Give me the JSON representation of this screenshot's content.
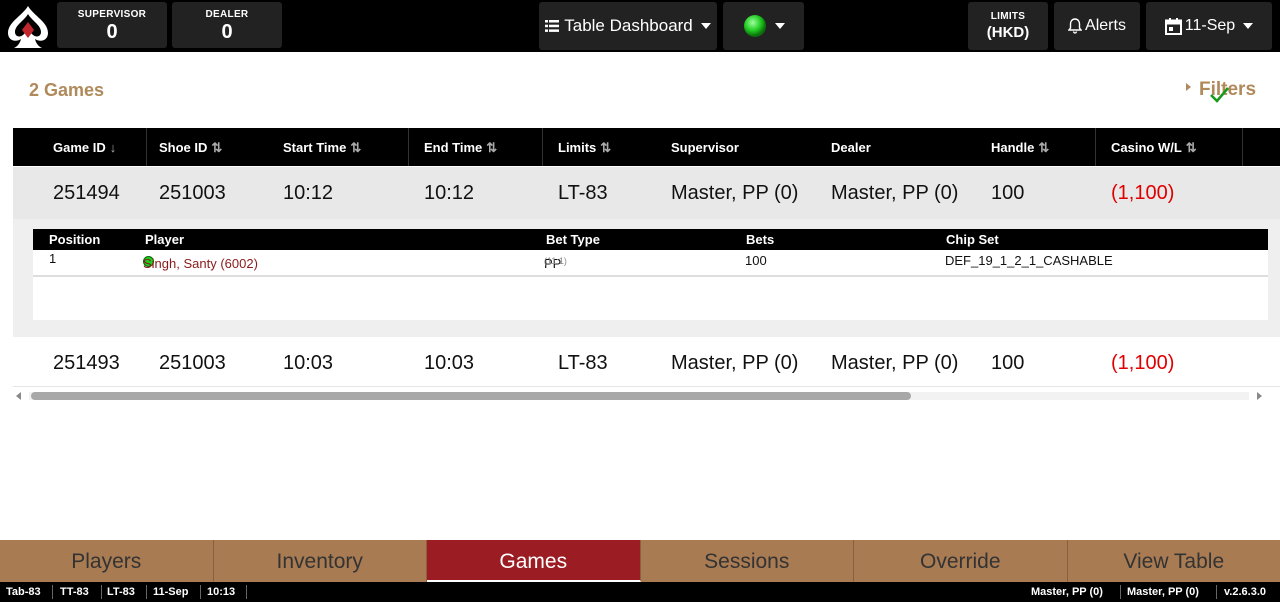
{
  "topbar": {
    "supervisor_label": "SUPERVISOR",
    "supervisor_value": "0",
    "dealer_label": "DEALER",
    "dealer_value": "0",
    "dashboard_label": "Table Dashboard",
    "status_color": "#22cc22",
    "limits_label": "LIMITS",
    "limits_value": "(HKD)",
    "alerts_label": "Alerts",
    "date_label": "11-Sep"
  },
  "main": {
    "games_count": "2 Games",
    "filters_label": "Filters"
  },
  "table": {
    "headers": [
      "Game ID",
      "Shoe ID",
      "Start Time",
      "End Time",
      "Limits",
      "Supervisor",
      "Dealer",
      "Handle",
      "Casino W/L"
    ],
    "rows": [
      {
        "game_id": "251494",
        "shoe_id": "251003",
        "start": "10:12",
        "end": "10:12",
        "limits": "LT-83",
        "supervisor": "Master, PP (0)",
        "dealer": "Master, PP (0)",
        "handle": "100",
        "casino_wl": "(1,100)"
      },
      {
        "game_id": "251493",
        "shoe_id": "251003",
        "start": "10:03",
        "end": "10:03",
        "limits": "LT-83",
        "supervisor": "Master, PP (0)",
        "dealer": "Master, PP (0)",
        "handle": "100",
        "casino_wl": "(1,100)"
      }
    ]
  },
  "detail": {
    "headers": [
      "Position",
      "Player",
      "Bet Type",
      "Bets",
      "Chip Set"
    ],
    "row": {
      "position": "1",
      "player": "Singh, Santy (6002)",
      "bet_type": "PP",
      "bet_odds": "(11:1)",
      "bets": "100",
      "chip_set": "DEF_19_1_2_1_CASHABLE"
    }
  },
  "tabs": [
    "Players",
    "Inventory",
    "Games",
    "Sessions",
    "Override",
    "View Table"
  ],
  "active_tab": "Games",
  "statusbar": {
    "items": [
      "Tab-83",
      "TT-83",
      "LT-83",
      "11-Sep",
      "10:13"
    ],
    "right_items": [
      "Master, PP (0)",
      "Master, PP (0)",
      "v.2.6.3.0"
    ]
  },
  "colors": {
    "accent_brown": "#b08a5a",
    "tab_bar": "#a97b53",
    "active_tab": "#9b1c22",
    "negative": "#e00000"
  },
  "icons": [
    "spade-logo-icon",
    "list-icon",
    "bell-icon",
    "calendar-icon",
    "check-icon",
    "sort-icon"
  ]
}
